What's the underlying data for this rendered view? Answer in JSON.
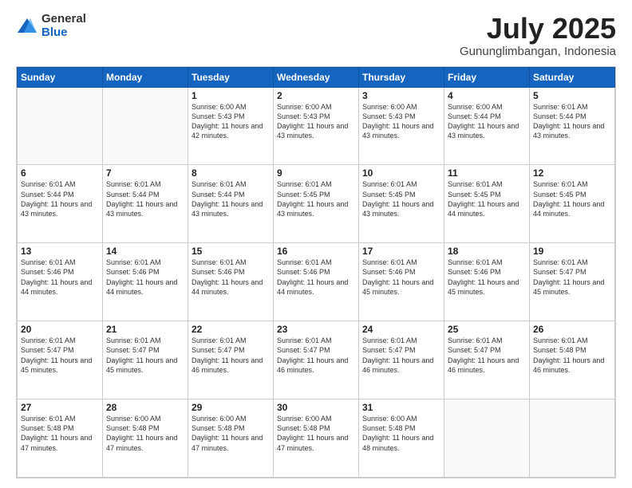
{
  "logo": {
    "general": "General",
    "blue": "Blue"
  },
  "header": {
    "month": "July 2025",
    "location": "Gununglimbangan, Indonesia"
  },
  "weekdays": [
    "Sunday",
    "Monday",
    "Tuesday",
    "Wednesday",
    "Thursday",
    "Friday",
    "Saturday"
  ],
  "weeks": [
    [
      {
        "day": "",
        "empty": true
      },
      {
        "day": "",
        "empty": true
      },
      {
        "day": "1",
        "sunrise": "6:00 AM",
        "sunset": "5:43 PM",
        "daylight": "11 hours and 42 minutes."
      },
      {
        "day": "2",
        "sunrise": "6:00 AM",
        "sunset": "5:43 PM",
        "daylight": "11 hours and 43 minutes."
      },
      {
        "day": "3",
        "sunrise": "6:00 AM",
        "sunset": "5:43 PM",
        "daylight": "11 hours and 43 minutes."
      },
      {
        "day": "4",
        "sunrise": "6:00 AM",
        "sunset": "5:44 PM",
        "daylight": "11 hours and 43 minutes."
      },
      {
        "day": "5",
        "sunrise": "6:01 AM",
        "sunset": "5:44 PM",
        "daylight": "11 hours and 43 minutes."
      }
    ],
    [
      {
        "day": "6",
        "sunrise": "6:01 AM",
        "sunset": "5:44 PM",
        "daylight": "11 hours and 43 minutes."
      },
      {
        "day": "7",
        "sunrise": "6:01 AM",
        "sunset": "5:44 PM",
        "daylight": "11 hours and 43 minutes."
      },
      {
        "day": "8",
        "sunrise": "6:01 AM",
        "sunset": "5:44 PM",
        "daylight": "11 hours and 43 minutes."
      },
      {
        "day": "9",
        "sunrise": "6:01 AM",
        "sunset": "5:45 PM",
        "daylight": "11 hours and 43 minutes."
      },
      {
        "day": "10",
        "sunrise": "6:01 AM",
        "sunset": "5:45 PM",
        "daylight": "11 hours and 43 minutes."
      },
      {
        "day": "11",
        "sunrise": "6:01 AM",
        "sunset": "5:45 PM",
        "daylight": "11 hours and 44 minutes."
      },
      {
        "day": "12",
        "sunrise": "6:01 AM",
        "sunset": "5:45 PM",
        "daylight": "11 hours and 44 minutes."
      }
    ],
    [
      {
        "day": "13",
        "sunrise": "6:01 AM",
        "sunset": "5:46 PM",
        "daylight": "11 hours and 44 minutes."
      },
      {
        "day": "14",
        "sunrise": "6:01 AM",
        "sunset": "5:46 PM",
        "daylight": "11 hours and 44 minutes."
      },
      {
        "day": "15",
        "sunrise": "6:01 AM",
        "sunset": "5:46 PM",
        "daylight": "11 hours and 44 minutes."
      },
      {
        "day": "16",
        "sunrise": "6:01 AM",
        "sunset": "5:46 PM",
        "daylight": "11 hours and 44 minutes."
      },
      {
        "day": "17",
        "sunrise": "6:01 AM",
        "sunset": "5:46 PM",
        "daylight": "11 hours and 45 minutes."
      },
      {
        "day": "18",
        "sunrise": "6:01 AM",
        "sunset": "5:46 PM",
        "daylight": "11 hours and 45 minutes."
      },
      {
        "day": "19",
        "sunrise": "6:01 AM",
        "sunset": "5:47 PM",
        "daylight": "11 hours and 45 minutes."
      }
    ],
    [
      {
        "day": "20",
        "sunrise": "6:01 AM",
        "sunset": "5:47 PM",
        "daylight": "11 hours and 45 minutes."
      },
      {
        "day": "21",
        "sunrise": "6:01 AM",
        "sunset": "5:47 PM",
        "daylight": "11 hours and 45 minutes."
      },
      {
        "day": "22",
        "sunrise": "6:01 AM",
        "sunset": "5:47 PM",
        "daylight": "11 hours and 46 minutes."
      },
      {
        "day": "23",
        "sunrise": "6:01 AM",
        "sunset": "5:47 PM",
        "daylight": "11 hours and 46 minutes."
      },
      {
        "day": "24",
        "sunrise": "6:01 AM",
        "sunset": "5:47 PM",
        "daylight": "11 hours and 46 minutes."
      },
      {
        "day": "25",
        "sunrise": "6:01 AM",
        "sunset": "5:47 PM",
        "daylight": "11 hours and 46 minutes."
      },
      {
        "day": "26",
        "sunrise": "6:01 AM",
        "sunset": "5:48 PM",
        "daylight": "11 hours and 46 minutes."
      }
    ],
    [
      {
        "day": "27",
        "sunrise": "6:01 AM",
        "sunset": "5:48 PM",
        "daylight": "11 hours and 47 minutes."
      },
      {
        "day": "28",
        "sunrise": "6:00 AM",
        "sunset": "5:48 PM",
        "daylight": "11 hours and 47 minutes."
      },
      {
        "day": "29",
        "sunrise": "6:00 AM",
        "sunset": "5:48 PM",
        "daylight": "11 hours and 47 minutes."
      },
      {
        "day": "30",
        "sunrise": "6:00 AM",
        "sunset": "5:48 PM",
        "daylight": "11 hours and 47 minutes."
      },
      {
        "day": "31",
        "sunrise": "6:00 AM",
        "sunset": "5:48 PM",
        "daylight": "11 hours and 48 minutes."
      },
      {
        "day": "",
        "empty": true
      },
      {
        "day": "",
        "empty": true
      }
    ]
  ]
}
